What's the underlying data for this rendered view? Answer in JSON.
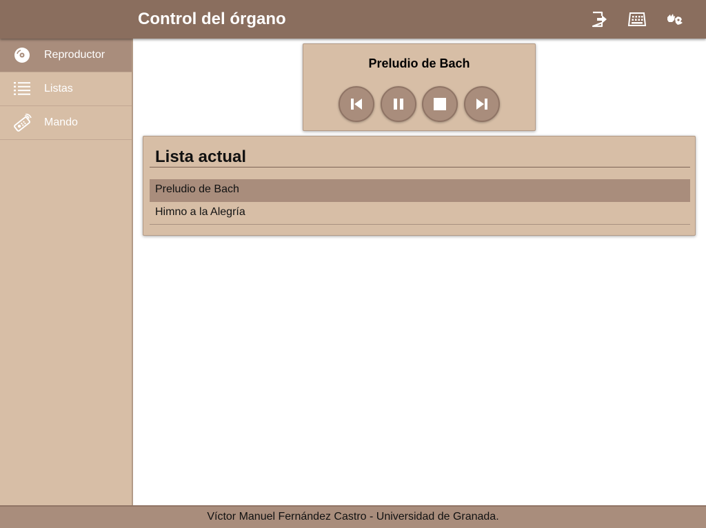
{
  "header": {
    "title": "Control del órgano",
    "icons": [
      "logout-icon",
      "keyboard-icon",
      "sign-language-icon"
    ]
  },
  "sidebar": {
    "items": [
      {
        "label": "Reproductor",
        "icon": "disc-icon",
        "active": true
      },
      {
        "label": "Listas",
        "icon": "list-icon",
        "active": false
      },
      {
        "label": "Mando",
        "icon": "remote-control-icon",
        "active": false
      }
    ]
  },
  "player": {
    "current_song": "Preludio de Bach",
    "controls": [
      "previous-icon",
      "pause-icon",
      "stop-icon",
      "next-icon"
    ]
  },
  "playlist": {
    "title": "Lista actual",
    "items": [
      "Preludio de Bach",
      "Himno a la Alegría"
    ],
    "selected_index": 0
  },
  "footer": {
    "text": "Víctor Manuel Fernández Castro - Universidad de Granada."
  },
  "colors": {
    "header": "#8a6e5e",
    "sidebar": "#d7bea6",
    "active": "#a98d7c",
    "card": "#d7bea6"
  }
}
